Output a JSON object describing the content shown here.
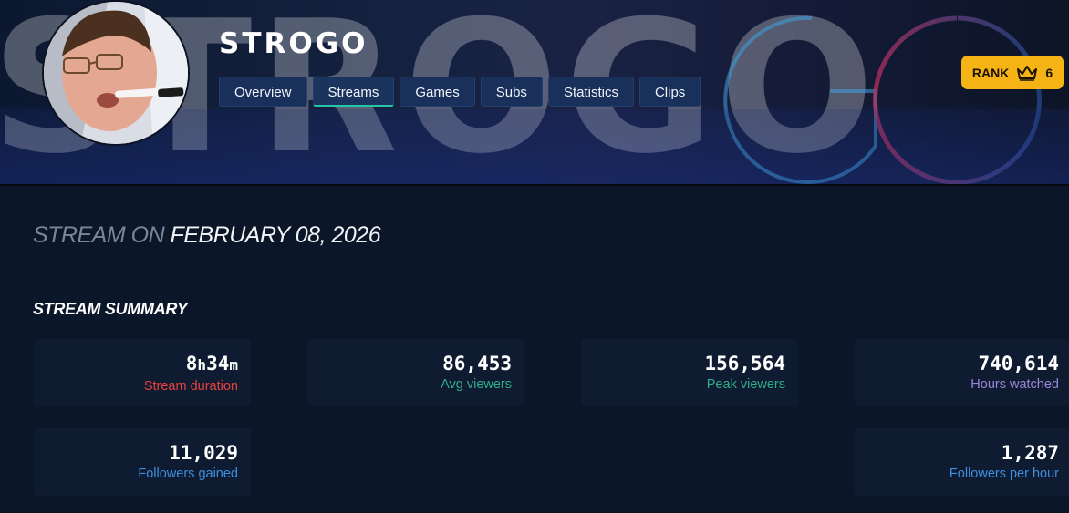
{
  "channel": {
    "name": "STROGO",
    "banner_text": "STROGO"
  },
  "tabs": [
    {
      "label": "Overview",
      "active": false
    },
    {
      "label": "Streams",
      "active": true
    },
    {
      "label": "Games",
      "active": false
    },
    {
      "label": "Subs",
      "active": false
    },
    {
      "label": "Statistics",
      "active": false
    },
    {
      "label": "Clips",
      "active": false
    }
  ],
  "rank": {
    "label": "RANK",
    "icon": "crown-icon",
    "value": "6",
    "color": "#f5b316"
  },
  "stream": {
    "prefix": "STREAM ON",
    "date": "FEBRUARY 08, 2026"
  },
  "summary": {
    "heading": "STREAM SUMMARY",
    "cards": [
      {
        "hours": "8",
        "h_unit": "h",
        "minutes": "34",
        "m_unit": "m",
        "label": "Stream duration",
        "color": "#e8413f"
      },
      {
        "value": "86,453",
        "label": "Avg viewers",
        "color": "#2fae8c"
      },
      {
        "value": "156,564",
        "label": "Peak viewers",
        "color": "#2fae8c"
      },
      {
        "value": "740,614",
        "label": "Hours watched",
        "color": "#9b86d9"
      },
      {
        "value": "11,029",
        "label": "Followers gained",
        "color": "#3d8fe0"
      },
      {
        "value": "1,287",
        "label": "Followers per hour",
        "color": "#3d8fe0"
      }
    ]
  }
}
